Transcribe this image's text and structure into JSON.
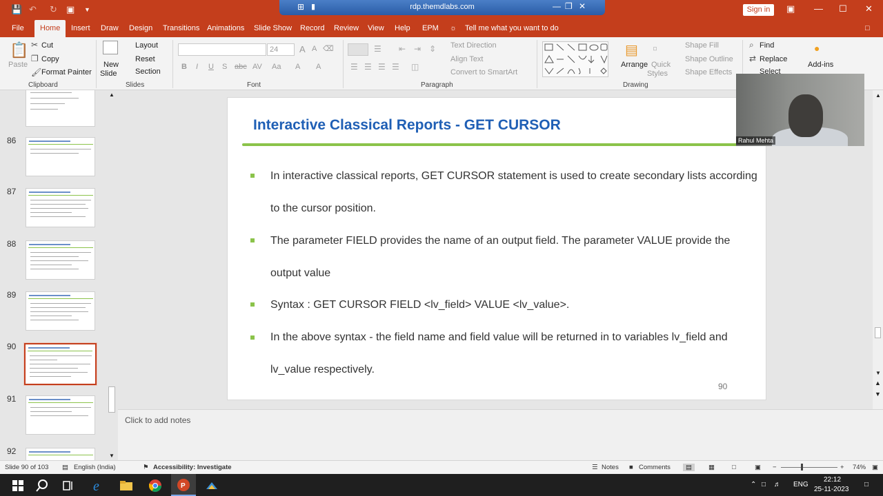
{
  "titlebar": {
    "rdp_title": "rdp.themdlabs.com",
    "sign_in": "Sign in"
  },
  "menu": [
    "File",
    "Home",
    "Insert",
    "Draw",
    "Design",
    "Transitions",
    "Animations",
    "Slide Show",
    "Record",
    "Review",
    "View",
    "Help",
    "EPM"
  ],
  "tell_me": "Tell me what you want to do",
  "ribbon": {
    "clipboard": {
      "paste": "Paste",
      "cut": "Cut",
      "copy": "Copy",
      "format_painter": "Format Painter",
      "label": "Clipboard"
    },
    "slides": {
      "new_slide_1": "New",
      "new_slide_2": "Slide",
      "layout": "Layout",
      "reset": "Reset",
      "section": "Section",
      "label": "Slides"
    },
    "font": {
      "label": "Font",
      "size": "24",
      "bold": "B",
      "italic": "I",
      "underline": "U",
      "strike": "S",
      "abc": "abc",
      "av": "AV",
      "aa": "Aa",
      "a": "A"
    },
    "paragraph": {
      "text_direction": "Text Direction",
      "align_text": "Align Text",
      "smartart": "Convert to SmartArt",
      "label": "Paragraph"
    },
    "drawing": {
      "arrange": "Arrange",
      "quick_styles_1": "Quick",
      "quick_styles_2": "Styles",
      "shape_fill": "Shape Fill",
      "shape_outline": "Shape Outline",
      "shape_effects": "Shape Effects",
      "label": "Drawing"
    },
    "editing": {
      "find": "Find",
      "replace": "Replace",
      "select": "Select"
    },
    "addins": "Add-ins"
  },
  "thumbnails": [
    {
      "num": "86"
    },
    {
      "num": "87"
    },
    {
      "num": "88"
    },
    {
      "num": "89"
    },
    {
      "num": "90",
      "selected": true
    },
    {
      "num": "91"
    },
    {
      "num": "92"
    }
  ],
  "slide": {
    "title": "Interactive Classical Reports - GET CURSOR",
    "bullets": [
      "In interactive classical reports,  GET CURSOR statement is used to create secondary lists according to the cursor position.",
      "The parameter FIELD provides the name of an output field. The parameter VALUE provide the output value",
      "Syntax :  GET CURSOR FIELD <lv_field> VALUE <lv_value>.",
      "In the above syntax - the field name and field value will be returned in to variables lv_field and lv_value respectively."
    ],
    "page_number": "90"
  },
  "webcam": {
    "name": "Rahul Mehta"
  },
  "notes_placeholder": "Click to add notes",
  "status": {
    "slide": "Slide 90 of 103",
    "language": "English (India)",
    "accessibility": "Accessibility: Investigate",
    "notes": "Notes",
    "comments": "Comments",
    "zoom": "74%"
  },
  "taskbar": {
    "lang": "ENG",
    "time": "22:12",
    "date": "25-11-2023"
  },
  "colors": {
    "accent": "#c43e1c",
    "title_blue": "#1f5fb5",
    "bullet_green": "#8bc34a"
  }
}
